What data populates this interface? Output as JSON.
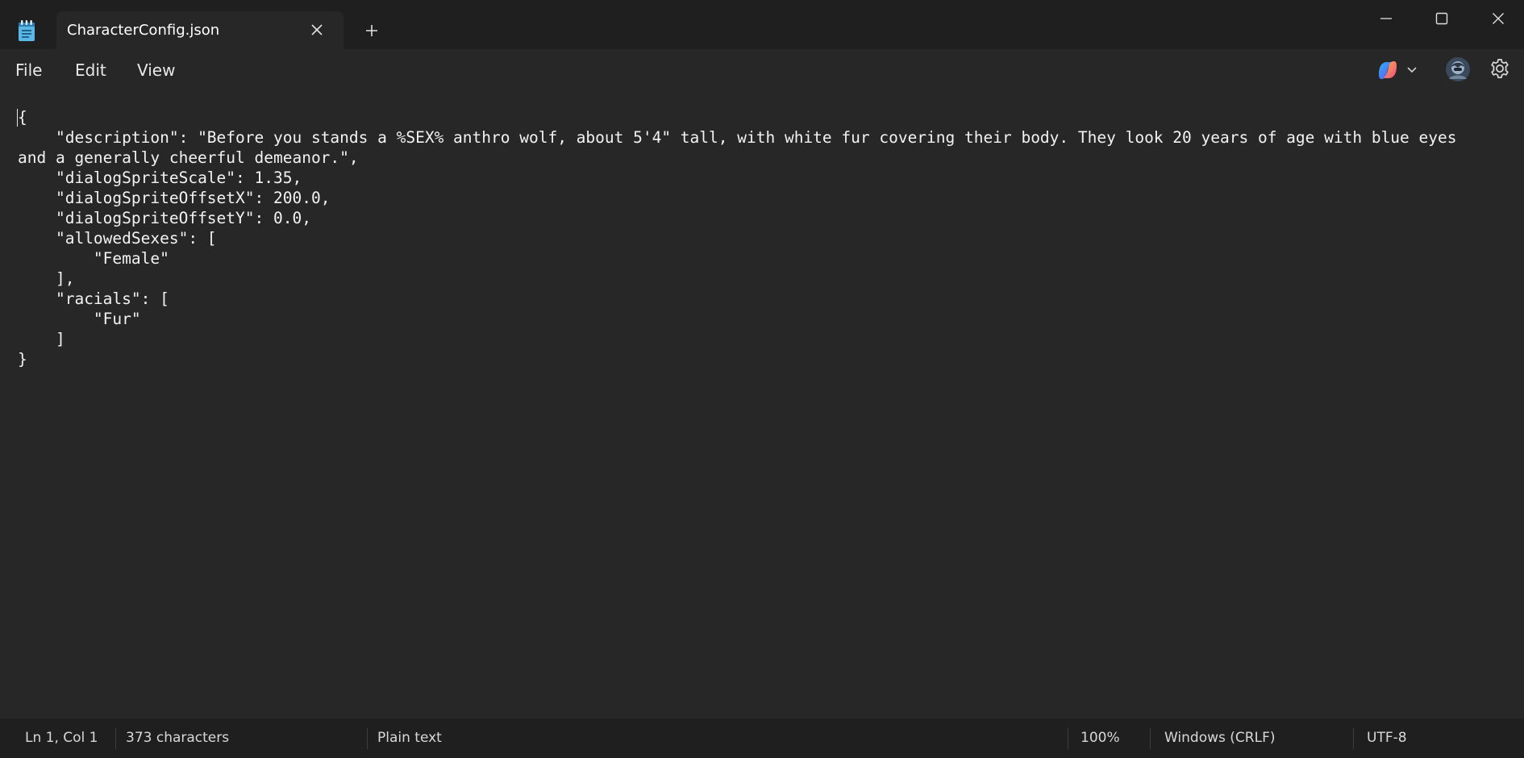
{
  "tab": {
    "title": "CharacterConfig.json"
  },
  "menu": {
    "file": "File",
    "edit": "Edit",
    "view": "View"
  },
  "icons": {
    "app": "notepad-icon",
    "tab_close": "close-icon",
    "new_tab": "plus-icon",
    "minimize": "minimize-icon",
    "maximize": "maximize-icon",
    "close": "close-icon",
    "copilot": "copilot-icon",
    "account": "avatar",
    "settings": "gear-icon"
  },
  "editor": {
    "content": "{\n    \"description\": \"Before you stands a %SEX% anthro wolf, about 5'4\" tall, with white fur covering their body. They look 20 years of age with blue eyes and a generally cheerful demeanor.\",\n    \"dialogSpriteScale\": 1.35,\n    \"dialogSpriteOffsetX\": 200.0,\n    \"dialogSpriteOffsetY\": 0.0,\n    \"allowedSexes\": [\n        \"Female\"\n    ],\n    \"racials\": [\n        \"Fur\"\n    ]\n}"
  },
  "status": {
    "position": "Ln 1, Col 1",
    "characters": "373 characters",
    "file_type": "Plain text",
    "zoom": "100%",
    "line_ending": "Windows (CRLF)",
    "encoding": "UTF-8"
  },
  "colors": {
    "titlebar_bg": "#1f1f1f",
    "editor_bg": "#272727",
    "text": "#f2f2f2",
    "app_icon": "#4fc3f7"
  }
}
